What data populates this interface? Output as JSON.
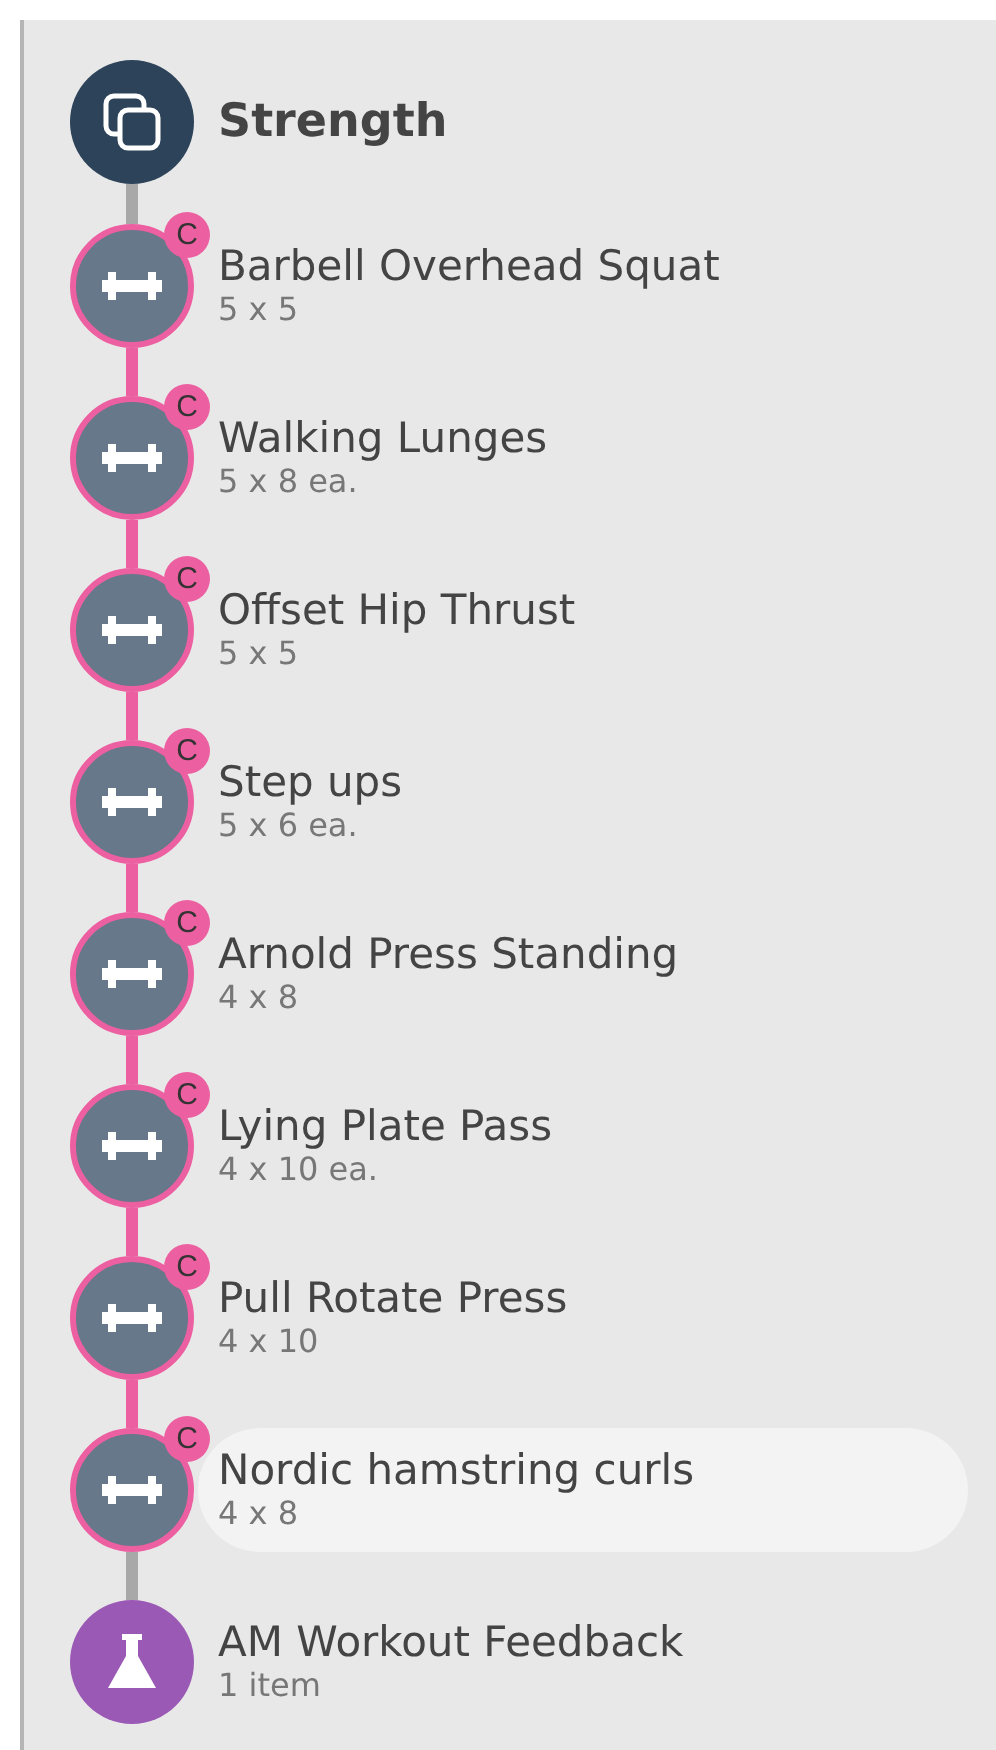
{
  "items": [
    {
      "kind": "section",
      "name": "Strength"
    },
    {
      "kind": "exercise",
      "name": "Barbell Overhead Squat",
      "detail": "5 x 5",
      "badge": "C",
      "selected": false
    },
    {
      "kind": "exercise",
      "name": "Walking Lunges",
      "detail": "5 x 8 ea.",
      "badge": "C",
      "selected": false
    },
    {
      "kind": "exercise",
      "name": "Offset Hip Thrust",
      "detail": "5 x 5",
      "badge": "C",
      "selected": false
    },
    {
      "kind": "exercise",
      "name": "Step ups",
      "detail": "5 x 6 ea.",
      "badge": "C",
      "selected": false
    },
    {
      "kind": "exercise",
      "name": "Arnold Press Standing",
      "detail": "4 x 8",
      "badge": "C",
      "selected": false
    },
    {
      "kind": "exercise",
      "name": "Lying Plate Pass",
      "detail": "4 x 10 ea.",
      "badge": "C",
      "selected": false
    },
    {
      "kind": "exercise",
      "name": "Pull Rotate Press",
      "detail": "4 x 10",
      "badge": "C",
      "selected": false
    },
    {
      "kind": "exercise",
      "name": "Nordic hamstring curls",
      "detail": "4 x 8",
      "badge": "C",
      "selected": true
    },
    {
      "kind": "survey",
      "name": "AM Workout Feedback",
      "detail": "1 item"
    }
  ]
}
